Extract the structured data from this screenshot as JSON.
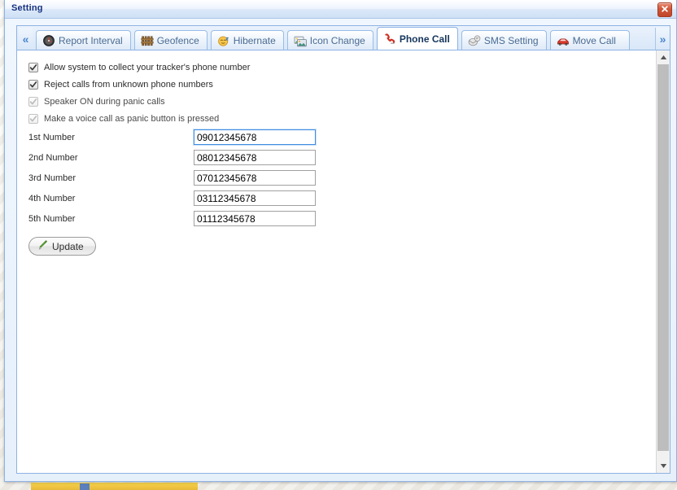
{
  "window": {
    "title": "Setting",
    "close_label": "×",
    "close_icon": "close-icon"
  },
  "tabstrip": {
    "scroll_left_label": "«",
    "scroll_right_label": "»",
    "tabs": [
      {
        "label": "Report Interval",
        "icon": "clock-icon",
        "active": false,
        "clipped": false
      },
      {
        "label": "Geofence",
        "icon": "fence-icon",
        "active": false,
        "clipped": false
      },
      {
        "label": "Hibernate",
        "icon": "sleep-icon",
        "active": false,
        "clipped": false
      },
      {
        "label": "Icon Change",
        "icon": "image-icon",
        "active": false,
        "clipped": false
      },
      {
        "label": "Phone Call",
        "icon": "phone-icon",
        "active": true,
        "clipped": false
      },
      {
        "label": "SMS Setting",
        "icon": "sms-icon",
        "active": false,
        "clipped": false
      },
      {
        "label": "Move Call",
        "icon": "car-icon",
        "active": false,
        "clipped": true
      }
    ]
  },
  "form": {
    "checkboxes": [
      {
        "label": "Allow system to collect your tracker's phone number",
        "checked": true,
        "disabled": false
      },
      {
        "label": "Reject calls from unknown phone numbers",
        "checked": true,
        "disabled": false
      },
      {
        "label": "Speaker ON during panic calls",
        "checked": true,
        "disabled": true
      },
      {
        "label": "Make a voice call as panic button is pressed",
        "checked": true,
        "disabled": true
      }
    ],
    "fields": [
      {
        "label": "1st Number",
        "value": "09012345678",
        "focused": true
      },
      {
        "label": "2nd Number",
        "value": "08012345678",
        "focused": false
      },
      {
        "label": "3rd Number",
        "value": "07012345678",
        "focused": false
      },
      {
        "label": "4th Number",
        "value": "03112345678",
        "focused": false
      },
      {
        "label": "5th Number",
        "value": "01112345678",
        "focused": false
      }
    ],
    "update_button": {
      "label": "Update",
      "icon": "pencil-icon"
    }
  },
  "scrollbar": {
    "up_label": "▲",
    "down_label": "▼"
  },
  "colors": {
    "title_text": "#15317e",
    "window_border": "#8db2e3",
    "tab_text": "#4a6b92",
    "active_tab_text": "#15365c",
    "focus_border": "#3f8de0",
    "close_button": "#cf5738",
    "pencil_green": "#5aa832"
  }
}
